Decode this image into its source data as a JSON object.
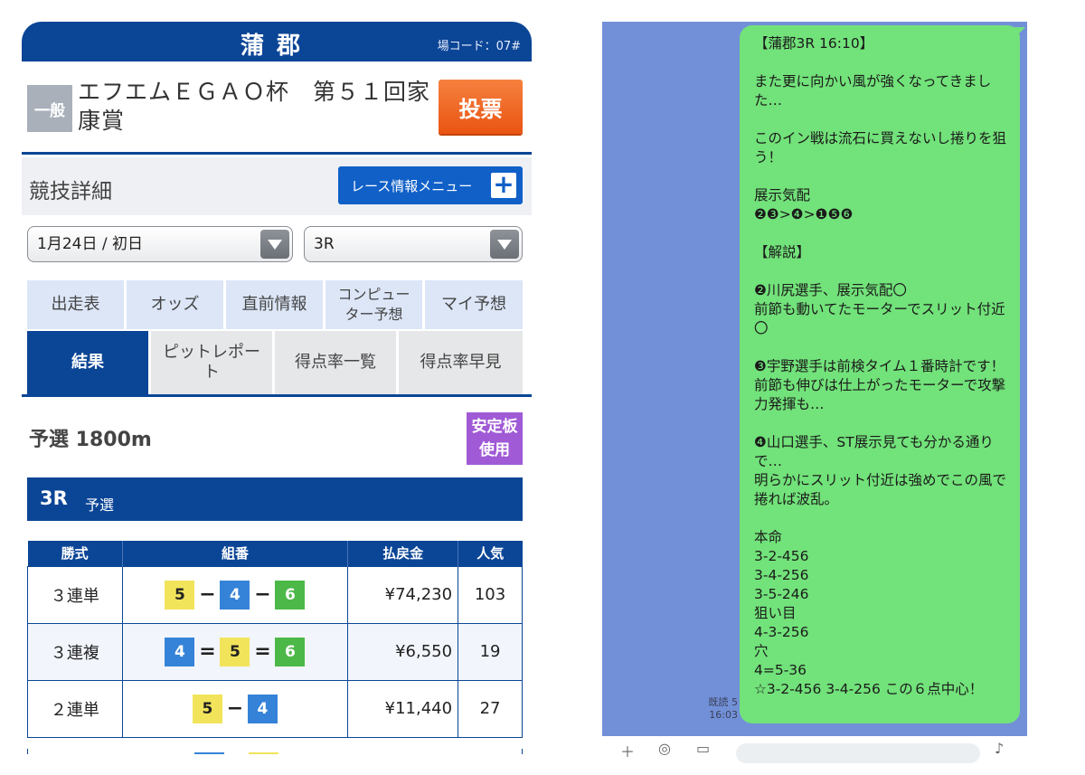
{
  "venue": {
    "name": "蒲郡",
    "code": "場コード：07#"
  },
  "race_header": {
    "grade": "一般",
    "title": "エフエムＥＧＡＯ杯　第５１回家康賞",
    "vote_label": "投票"
  },
  "detail": {
    "title": "競技詳細",
    "menu_button": "レース情報メニュー",
    "menu_icon": "plus-icon"
  },
  "selects": {
    "date": "1月24日 / 初日",
    "race": "3R"
  },
  "tabs_row1": [
    "出走表",
    "オッズ",
    "直前情報",
    "コンピューター予想",
    "マイ予想"
  ],
  "tabs_row2": [
    "結果",
    "ピットレポート",
    "得点率一覧",
    "得点率早見"
  ],
  "active_tab": "結果",
  "race_info": {
    "label": "予選 1800m",
    "stable_board": "安定板使用",
    "race_no": "3R",
    "race_type": "予選"
  },
  "results_table": {
    "headers": [
      "勝式",
      "組番",
      "払戻金",
      "人気"
    ],
    "rows": [
      {
        "kind": "３連単",
        "boats": [
          "5",
          "4",
          "6"
        ],
        "separator": "−",
        "payout": "¥74,230",
        "popularity": "103"
      },
      {
        "kind": "３連複",
        "boats": [
          "4",
          "5",
          "6"
        ],
        "separator": "=",
        "payout": "¥6,550",
        "popularity": "19"
      },
      {
        "kind": "２連単",
        "boats": [
          "5",
          "4"
        ],
        "separator": "−",
        "payout": "¥11,440",
        "popularity": "27"
      }
    ]
  },
  "boat_colors": {
    "4": "#3583d8",
    "5": "#f1e45b",
    "6": "#4cb848"
  },
  "chat": {
    "message": "【蒲郡3R 16:10】\n\nまた更に向かい風が強くなってきました…\n\nこのイン戦は流石に買えないし捲りを狙う！\n\n展示気配\n❷❸>❹>❶❺❻\n\n【解説】\n\n❷川尻選手、展示気配〇\n前節も動いてたモーターでスリット付近〇\n\n❸宇野選手は前検タイム１番時計です！\n前節も伸びは仕上がったモーターで攻撃力発揮も…\n\n❹山口選手、ST展示見ても分かる通りで…\n明らかにスリット付近は強めでこの風で捲れば波乱。\n\n本命\n3-2-456\n3-4-256\n3-5-246\n狙い目\n4-3-256\n穴\n4=5-36\n☆3-2-456 3-4-256 この６点中心！",
    "read_status": "既読 5",
    "time": "16:03",
    "bubble_color": "#72e27a",
    "background_color": "#7290d8"
  }
}
